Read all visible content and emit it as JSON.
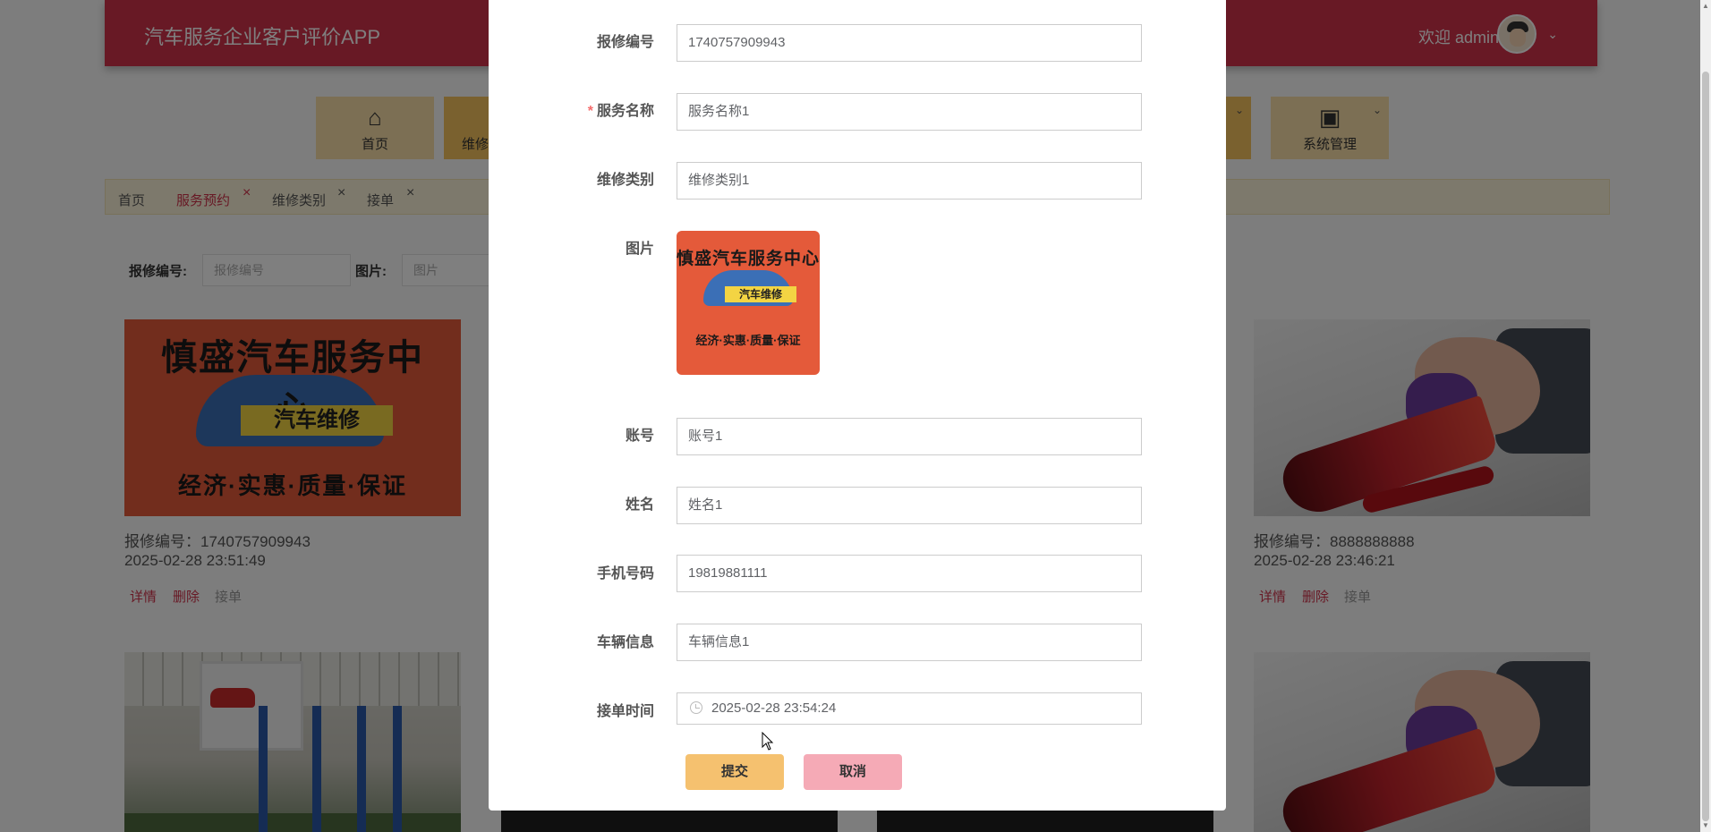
{
  "header": {
    "app_title": "汽车服务企业客户评价APP",
    "welcome": "欢迎 admin"
  },
  "nav": {
    "tiles": [
      {
        "label": "首页",
        "icon": "home-icon"
      },
      {
        "label": "维修",
        "icon": "wrench-icon"
      },
      {
        "label": "系统管理",
        "icon": "chip-icon"
      }
    ]
  },
  "breadcrumb": {
    "items": [
      "首页",
      "服务预约",
      "维修类别",
      "接单"
    ]
  },
  "search": {
    "label1": "报修编号:",
    "placeholder1": "报修编号",
    "label2": "图片:",
    "placeholder2": "图片"
  },
  "cards": [
    {
      "number": "报修编号：1740757909943",
      "time": "2025-02-28 23:51:49",
      "detail": "详情",
      "delete": "删除",
      "accept": "接单"
    },
    {
      "number": "报修编号：8888888888",
      "time": "2025-02-28 23:46:21",
      "detail": "详情",
      "delete": "删除",
      "accept": "接单"
    }
  ],
  "sign": {
    "arc": "慎盛汽车服务中心",
    "band": "汽车维修",
    "bottom": "经济·实惠·质量·保证"
  },
  "preview_sign": {
    "arc": "慎盛汽车服务中心",
    "band": "汽车维修",
    "bottom": "经济·实惠·质量·保证"
  },
  "form": {
    "repair_no_label": "报修编号",
    "repair_no_value": "1740757909943",
    "service_name_label": "服务名称",
    "service_name_value": "服务名称1",
    "repair_type_label": "维修类别",
    "repair_type_value": "维修类别1",
    "image_label": "图片",
    "account_label": "账号",
    "account_value": "账号1",
    "name_label": "姓名",
    "name_value": "姓名1",
    "phone_label": "手机号码",
    "phone_value": "19819881111",
    "vehicle_label": "车辆信息",
    "vehicle_value": "车辆信息1",
    "accept_time_label": "接单时间",
    "accept_time_value": "2025-02-28 23:54:24",
    "required_mark": "*"
  },
  "buttons": {
    "submit": "提交",
    "cancel": "取消"
  },
  "colors": {
    "brand": "#d0324a",
    "submit": "#f5c16f",
    "cancel": "#f5aab6"
  }
}
